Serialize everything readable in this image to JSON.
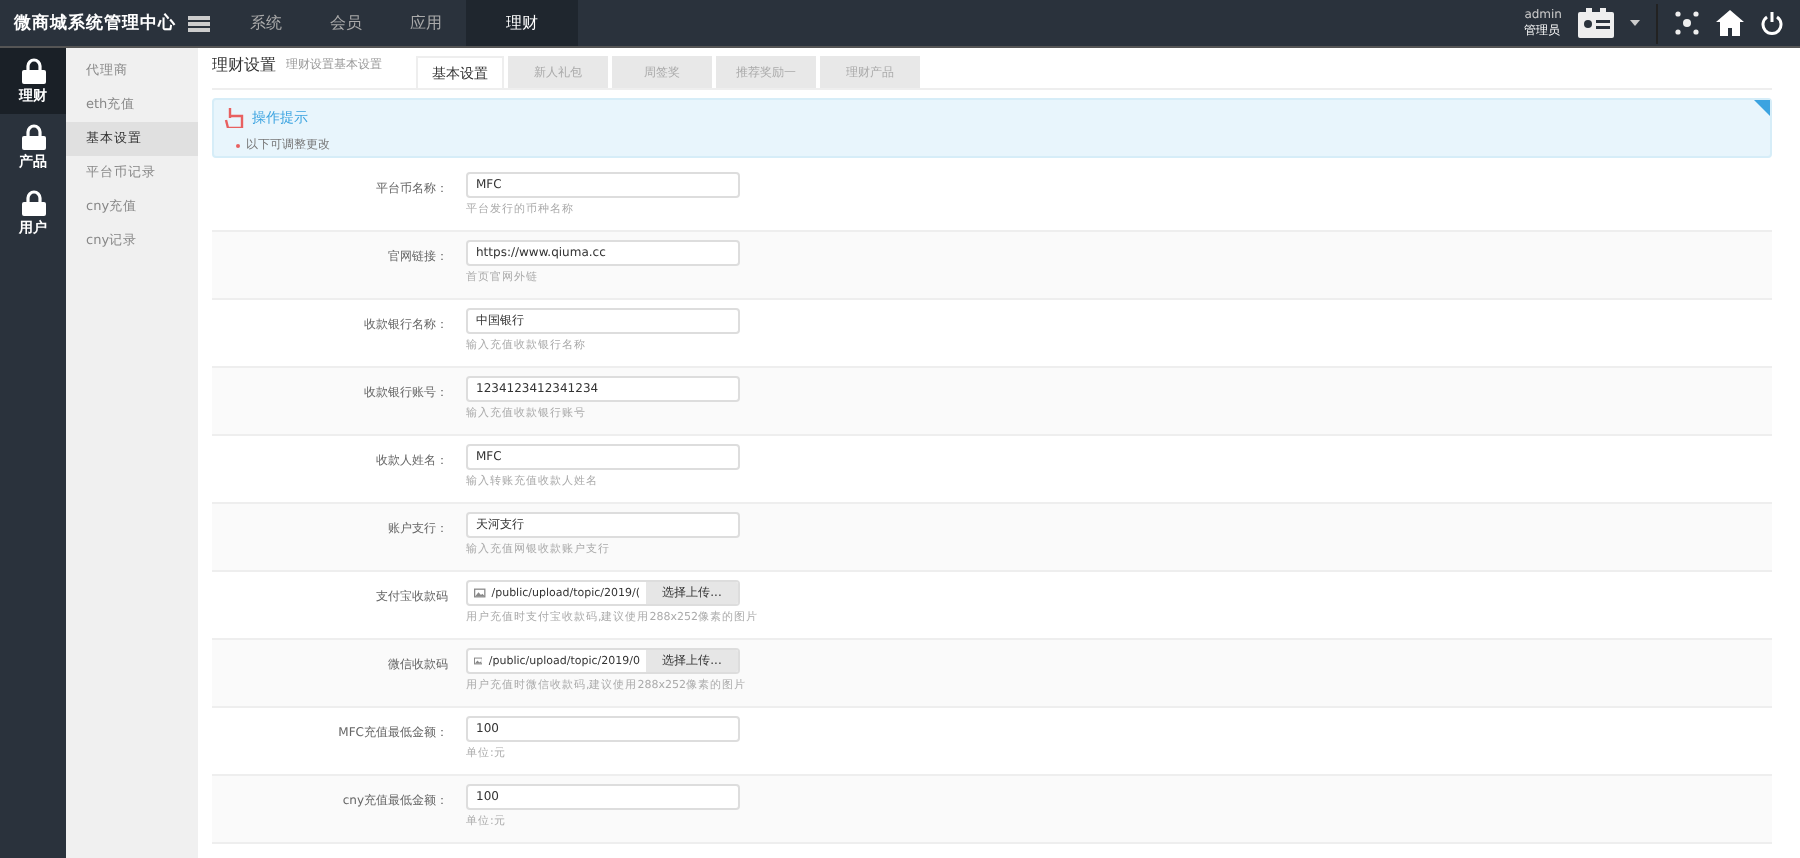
{
  "topbar": {
    "title": "微商城系统管理中心",
    "nav": [
      {
        "label": "系统",
        "selected": false
      },
      {
        "label": "会员",
        "selected": false
      },
      {
        "label": "应用",
        "selected": false
      },
      {
        "label": "理财",
        "selected": true
      }
    ],
    "user": {
      "name": "admin",
      "role": "管理员"
    }
  },
  "icon_sidebar": [
    {
      "label": "理财",
      "selected": true
    },
    {
      "label": "产品",
      "selected": false
    },
    {
      "label": "用户",
      "selected": false
    }
  ],
  "sub_sidebar": [
    {
      "label": "代理商",
      "selected": false
    },
    {
      "label": "eth充值",
      "selected": false
    },
    {
      "label": "基本设置",
      "selected": true
    },
    {
      "label": "平台币记录",
      "selected": false
    },
    {
      "label": "cny充值",
      "selected": false
    },
    {
      "label": "cny记录",
      "selected": false
    }
  ],
  "header": {
    "title": "理财设置",
    "subtitle": "理财设置基本设置"
  },
  "tabs": [
    {
      "label": "基本设置",
      "selected": true
    },
    {
      "label": "新人礼包",
      "selected": false
    },
    {
      "label": "周签奖",
      "selected": false
    },
    {
      "label": "推荐奖励一",
      "selected": false
    },
    {
      "label": "理财产品",
      "selected": false
    }
  ],
  "tip": {
    "title": "操作提示",
    "items": [
      "以下可调整更改"
    ]
  },
  "form": [
    {
      "kind": "text",
      "label": "平台币名称：",
      "value": "MFC",
      "hint": "平台发行的币种名称"
    },
    {
      "kind": "text",
      "label": "官网链接：",
      "value": "https://www.qiuma.cc",
      "hint": "首页官网外链"
    },
    {
      "kind": "text",
      "label": "收款银行名称：",
      "value": "中国银行",
      "hint": "输入充值收款银行名称"
    },
    {
      "kind": "text",
      "label": "收款银行账号：",
      "value": "1234123412341234",
      "hint": "输入充值收款银行账号"
    },
    {
      "kind": "text",
      "label": "收款人姓名：",
      "value": "MFC",
      "hint": "输入转账充值收款人姓名"
    },
    {
      "kind": "text",
      "label": "账户支行：",
      "value": "天河支行",
      "hint": "输入充值网银收款账户支行"
    },
    {
      "kind": "file",
      "label": "支付宝收款码",
      "value": "/public/upload/topic/2019/(",
      "button": "选择上传...",
      "hint": "用户充值时支付宝收款码,建议使用288x252像素的图片"
    },
    {
      "kind": "file",
      "label": "微信收款码",
      "value": "/public/upload/topic/2019/0",
      "button": "选择上传...",
      "hint": "用户充值时微信收款码,建议使用288x252像素的图片"
    },
    {
      "kind": "text",
      "label": "MFC充值最低金额：",
      "value": "100",
      "hint": "单位:元"
    },
    {
      "kind": "text",
      "label": "cny充值最低金额：",
      "value": "100",
      "hint": "单位:元"
    }
  ]
}
